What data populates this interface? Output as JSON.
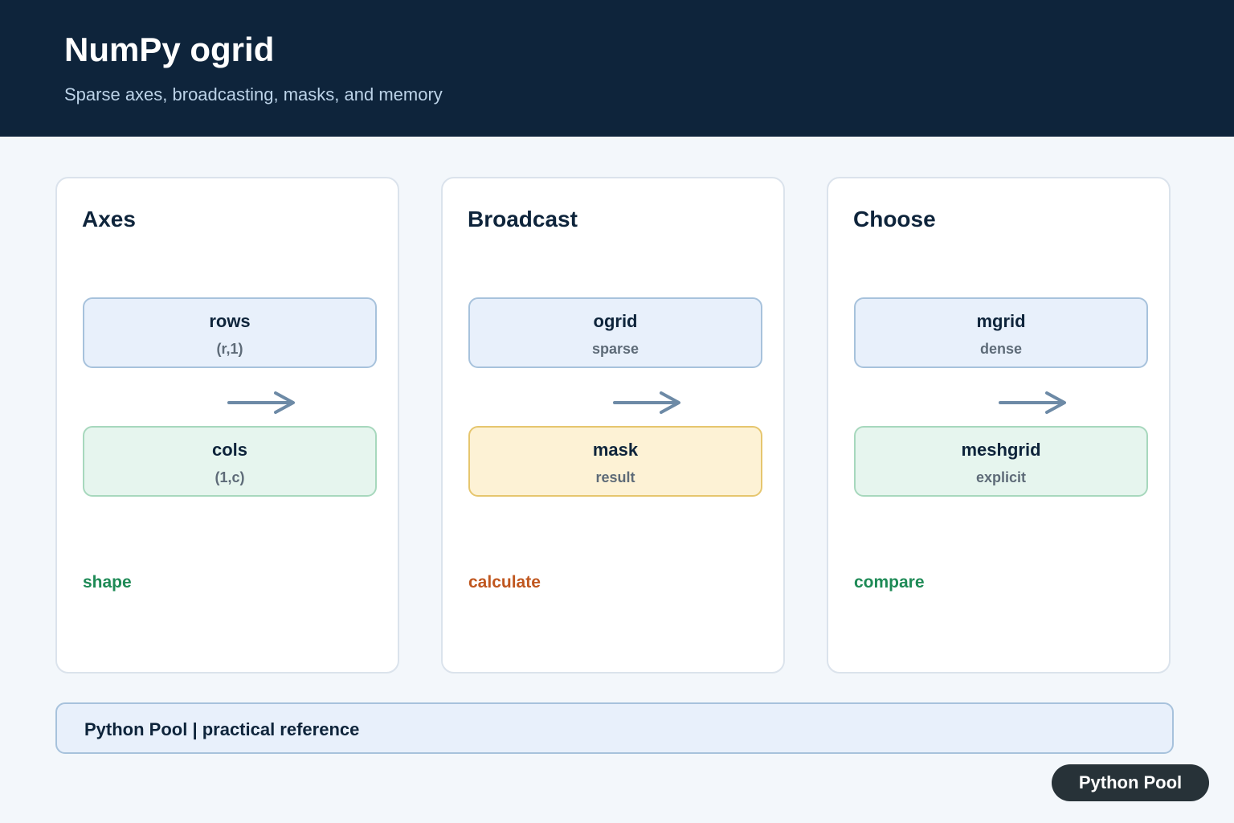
{
  "header": {
    "title": "NumPy ogrid",
    "subtitle": "Sparse axes, broadcasting, masks, and memory"
  },
  "cards": [
    {
      "title": "Axes",
      "top_node": {
        "label": "rows",
        "sub": "(r,1)",
        "color": "blue"
      },
      "bottom_node": {
        "label": "cols",
        "sub": "(1,c)",
        "color": "green"
      },
      "tag": "shape",
      "tag_color": "#1e8a56"
    },
    {
      "title": "Broadcast",
      "top_node": {
        "label": "ogrid",
        "sub": "sparse",
        "color": "blue"
      },
      "bottom_node": {
        "label": "mask",
        "sub": "result",
        "color": "yellow"
      },
      "tag": "calculate",
      "tag_color": "#c0571f"
    },
    {
      "title": "Choose",
      "top_node": {
        "label": "mgrid",
        "sub": "dense",
        "color": "blue"
      },
      "bottom_node": {
        "label": "meshgrid",
        "sub": "explicit",
        "color": "green"
      },
      "tag": "compare",
      "tag_color": "#1e8a56"
    }
  ],
  "footer": {
    "text": "Python Pool | practical reference"
  },
  "badge": {
    "text": "Python Pool"
  },
  "colors": {
    "header_bg": "#0e243b",
    "arrow": "#6d8aa6",
    "blue_fill": "#e8f0fb",
    "green_fill": "#e6f5ee",
    "yellow_fill": "#fdf2d5"
  }
}
